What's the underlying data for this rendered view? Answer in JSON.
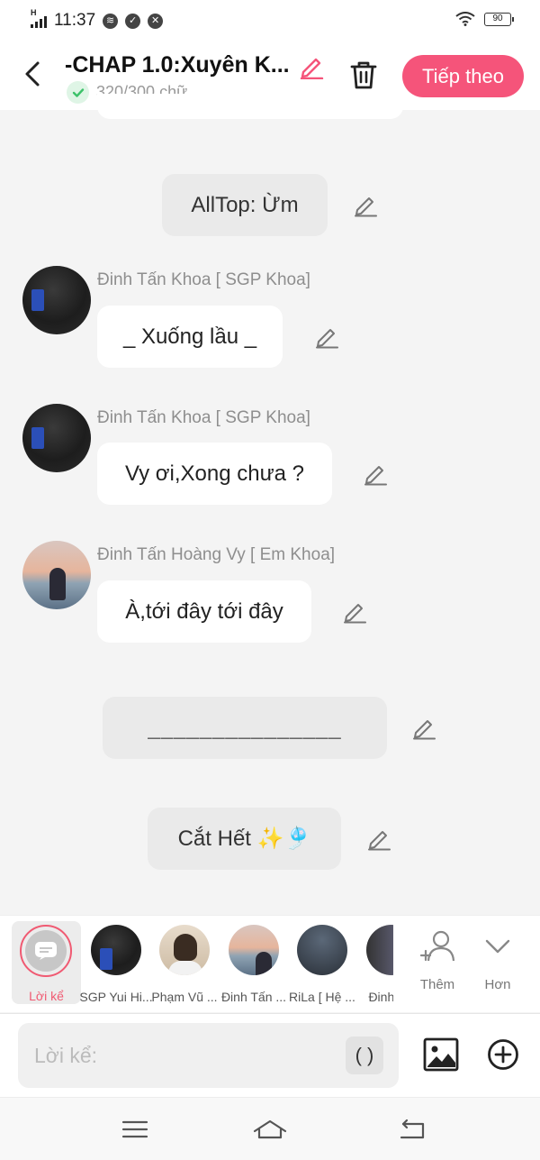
{
  "status_bar": {
    "time": "11:37",
    "battery": "90",
    "network": "H"
  },
  "header": {
    "title": "-CHAP 1.0:Xuyên K...",
    "word_count": "320/300 chữ",
    "next_label": "Tiếp theo"
  },
  "messages": [
    {
      "type": "narration",
      "text": "AllTop: Ừm"
    },
    {
      "type": "chat",
      "sender": "Đinh Tấn Khoa [ SGP Khoa]",
      "text": "_ Xuống lầu _"
    },
    {
      "type": "chat",
      "sender": "Đinh Tấn Khoa [ SGP Khoa]",
      "text": "Vy ơi,Xong chưa ?"
    },
    {
      "type": "chat",
      "sender": "Đinh Tấn Hoàng Vy [ Em Khoa]",
      "text": "À,tới đây tới đây"
    },
    {
      "type": "narration",
      "text": "_______________"
    },
    {
      "type": "narration",
      "text": "Cắt Hết ✨🎐"
    }
  ],
  "characters": {
    "narrator_label": "Lời kể",
    "items": [
      {
        "name": "SGP Yui Hi..."
      },
      {
        "name": "Phạm Vũ ..."
      },
      {
        "name": "Đinh Tấn ..."
      },
      {
        "name": "RiLa [ Hệ ..."
      },
      {
        "name": "Đinh T..."
      }
    ],
    "more_label": "Thêm",
    "collapse_label": "Hơn"
  },
  "input": {
    "placeholder": "Lời kể:",
    "paren_button": "( )"
  },
  "colors": {
    "accent": "#f5547a",
    "narrator_ring": "#f05a72",
    "check_green": "#3cc26a"
  }
}
